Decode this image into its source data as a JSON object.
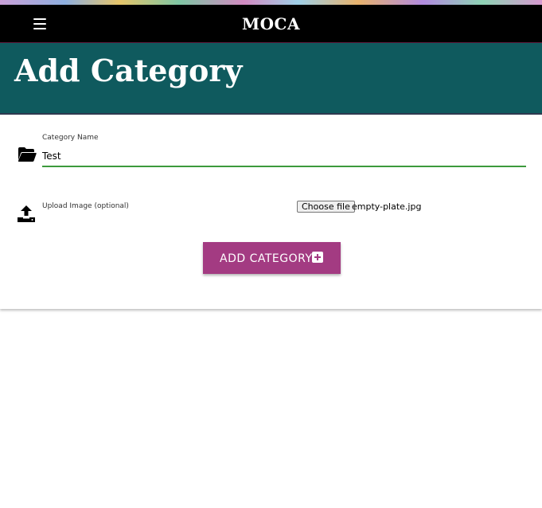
{
  "nav": {
    "brand": "MOCA",
    "menu_icon": "hamburger-menu-icon"
  },
  "header": {
    "title": "Add Category",
    "background_color": "#0f5a5e"
  },
  "form": {
    "category_name": {
      "label": "Category Name",
      "value": "Test",
      "icon": "folder-open-icon"
    },
    "upload": {
      "label": "Upload Image (optional)",
      "button_label": "Choose file",
      "file_name": "empty-plate.jpg",
      "icon": "upload-icon"
    },
    "submit": {
      "label": "ADD CATEGORY",
      "icon": "plus-square-icon",
      "color": "#a33b82"
    }
  }
}
